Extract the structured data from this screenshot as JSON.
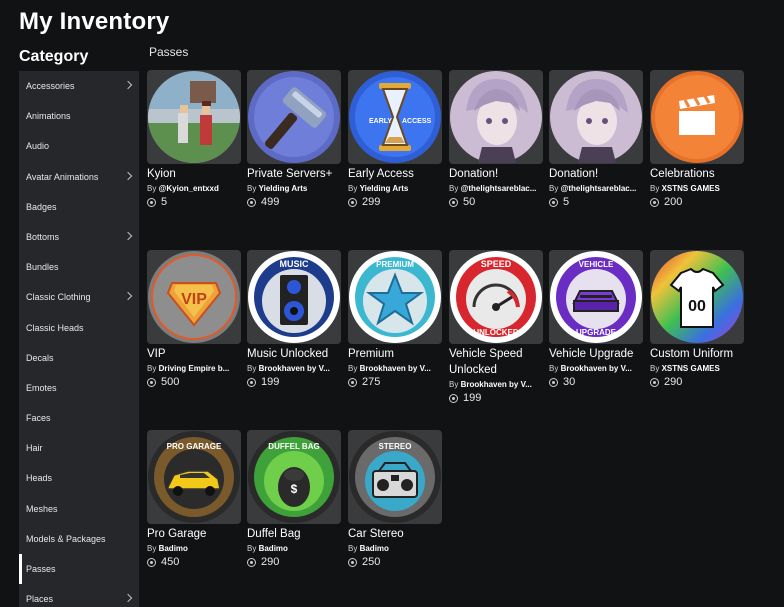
{
  "page_title": "My Inventory",
  "category_title": "Category",
  "sidebar": {
    "items": [
      {
        "label": "Accessories",
        "chevron": true
      },
      {
        "label": "Animations",
        "chevron": false
      },
      {
        "label": "Audio",
        "chevron": false
      },
      {
        "label": "Avatar Animations",
        "chevron": true
      },
      {
        "label": "Badges",
        "chevron": false
      },
      {
        "label": "Bottoms",
        "chevron": true
      },
      {
        "label": "Bundles",
        "chevron": false
      },
      {
        "label": "Classic Clothing",
        "chevron": true
      },
      {
        "label": "Classic Heads",
        "chevron": false
      },
      {
        "label": "Decals",
        "chevron": false
      },
      {
        "label": "Emotes",
        "chevron": false
      },
      {
        "label": "Faces",
        "chevron": false
      },
      {
        "label": "Hair",
        "chevron": false
      },
      {
        "label": "Heads",
        "chevron": false
      },
      {
        "label": "Meshes",
        "chevron": false
      },
      {
        "label": "Models & Packages",
        "chevron": false
      },
      {
        "label": "Passes",
        "chevron": false,
        "active": true
      },
      {
        "label": "Places",
        "chevron": true
      }
    ]
  },
  "section_title": "Passes",
  "items": [
    {
      "name": "Kyion",
      "by": "By",
      "creator": "@Kyion_entxxd",
      "price": "5",
      "icon": "game-scene-icon"
    },
    {
      "name": "Private Servers+",
      "by": "By",
      "creator": "Yielding Arts",
      "price": "499",
      "icon": "hammer-icon"
    },
    {
      "name": "Early Access",
      "by": "By",
      "creator": "Yielding Arts",
      "price": "299",
      "icon": "hourglass-icon"
    },
    {
      "name": "Donation!",
      "by": "By",
      "creator": "@thelightsareblac...",
      "price": "50",
      "icon": "anime-portrait-icon"
    },
    {
      "name": "Donation!",
      "by": "By",
      "creator": "@thelightsareblac...",
      "price": "5",
      "icon": "anime-portrait-icon"
    },
    {
      "name": "Celebrations",
      "by": "By",
      "creator": "XSTNS GAMES",
      "price": "200",
      "icon": "clapperboard-icon"
    },
    {
      "name": "VIP",
      "by": "By",
      "creator": "Driving Empire b...",
      "price": "500",
      "icon": "vip-badge-icon"
    },
    {
      "name": "Music Unlocked",
      "by": "By",
      "creator": "Brookhaven by V...",
      "price": "199",
      "icon": "speaker-icon"
    },
    {
      "name": "Premium",
      "by": "By",
      "creator": "Brookhaven by V...",
      "price": "275",
      "icon": "star-icon"
    },
    {
      "name": "Vehicle Speed Unlocked",
      "by": "By",
      "creator": "Brookhaven by V...",
      "price": "199",
      "icon": "speedometer-icon"
    },
    {
      "name": "Vehicle Upgrade",
      "by": "By",
      "creator": "Brookhaven by V...",
      "price": "30",
      "icon": "vehicle-upgrade-icon"
    },
    {
      "name": "Custom Uniform",
      "by": "By",
      "creator": "XSTNS GAMES",
      "price": "290",
      "icon": "jersey-icon"
    },
    {
      "name": "Pro Garage",
      "by": "By",
      "creator": "Badimo",
      "price": "450",
      "icon": "car-icon"
    },
    {
      "name": "Duffel Bag",
      "by": "By",
      "creator": "Badimo",
      "price": "290",
      "icon": "duffel-bag-icon"
    },
    {
      "name": "Car Stereo",
      "by": "By",
      "creator": "Badimo",
      "price": "250",
      "icon": "stereo-icon"
    }
  ],
  "badge_text": {
    "early_access": "EARLY ACCESS",
    "vip": "VIP",
    "music": "MUSIC",
    "premium": "PREMIUM",
    "speed": "SPEED",
    "unlocked": "UNLOCKED",
    "vehicle": "VEHICLE",
    "upgrade": "UPGRADE",
    "jersey_number": "00",
    "pro_garage": "PRO GARAGE",
    "duffel_bag": "DUFFEL BAG",
    "stereo": "STEREO"
  },
  "colors": {
    "background": "#111214",
    "sidebar": "#26272b",
    "card": "#393b3d"
  }
}
